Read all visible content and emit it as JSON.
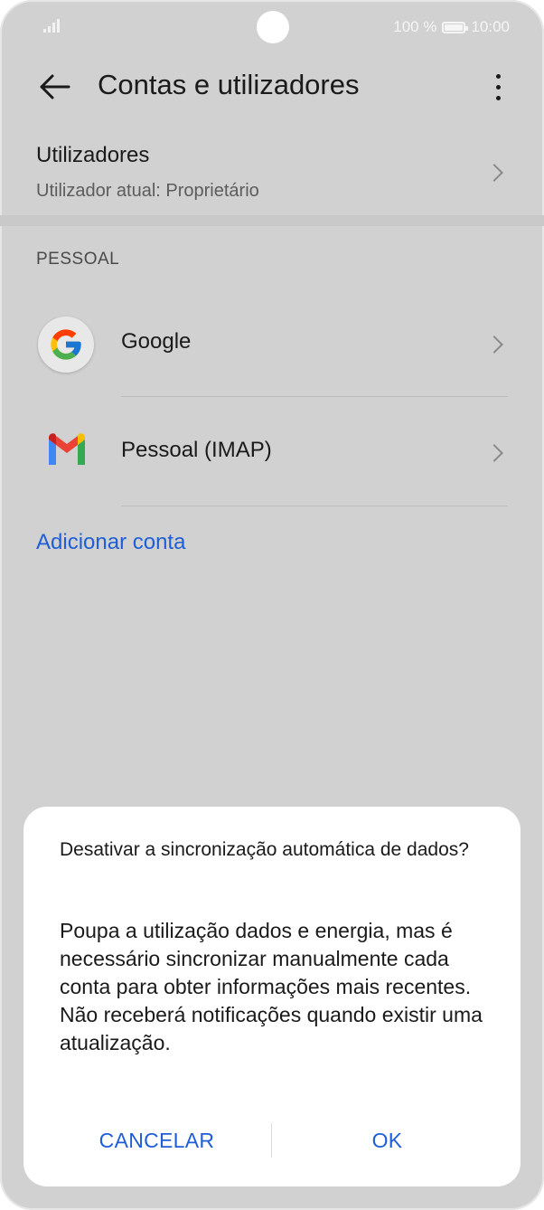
{
  "status_bar": {
    "battery_percent": "100 %",
    "time": "10:00"
  },
  "app_bar": {
    "title": "Contas e utilizadores"
  },
  "users": {
    "title": "Utilizadores",
    "subtitle": "Utilizador atual: Proprietário"
  },
  "personal": {
    "header": "PESSOAL",
    "accounts": [
      {
        "label": "Google",
        "icon": "google-icon"
      },
      {
        "label": "Pessoal (IMAP)",
        "icon": "gmail-icon"
      }
    ],
    "add_account_label": "Adicionar conta"
  },
  "dialog": {
    "title": "Desativar a sincronização automática de dados?",
    "body": "Poupa a utilização dados e energia, mas é necessário sincronizar manualmente cada conta para obter informações mais recentes. Não receberá notificações quando existir uma atualização.",
    "cancel_label": "CANCELAR",
    "ok_label": "OK"
  },
  "colors": {
    "accent": "#1f5ed6",
    "dimmed_background": "#d1d1d1"
  }
}
